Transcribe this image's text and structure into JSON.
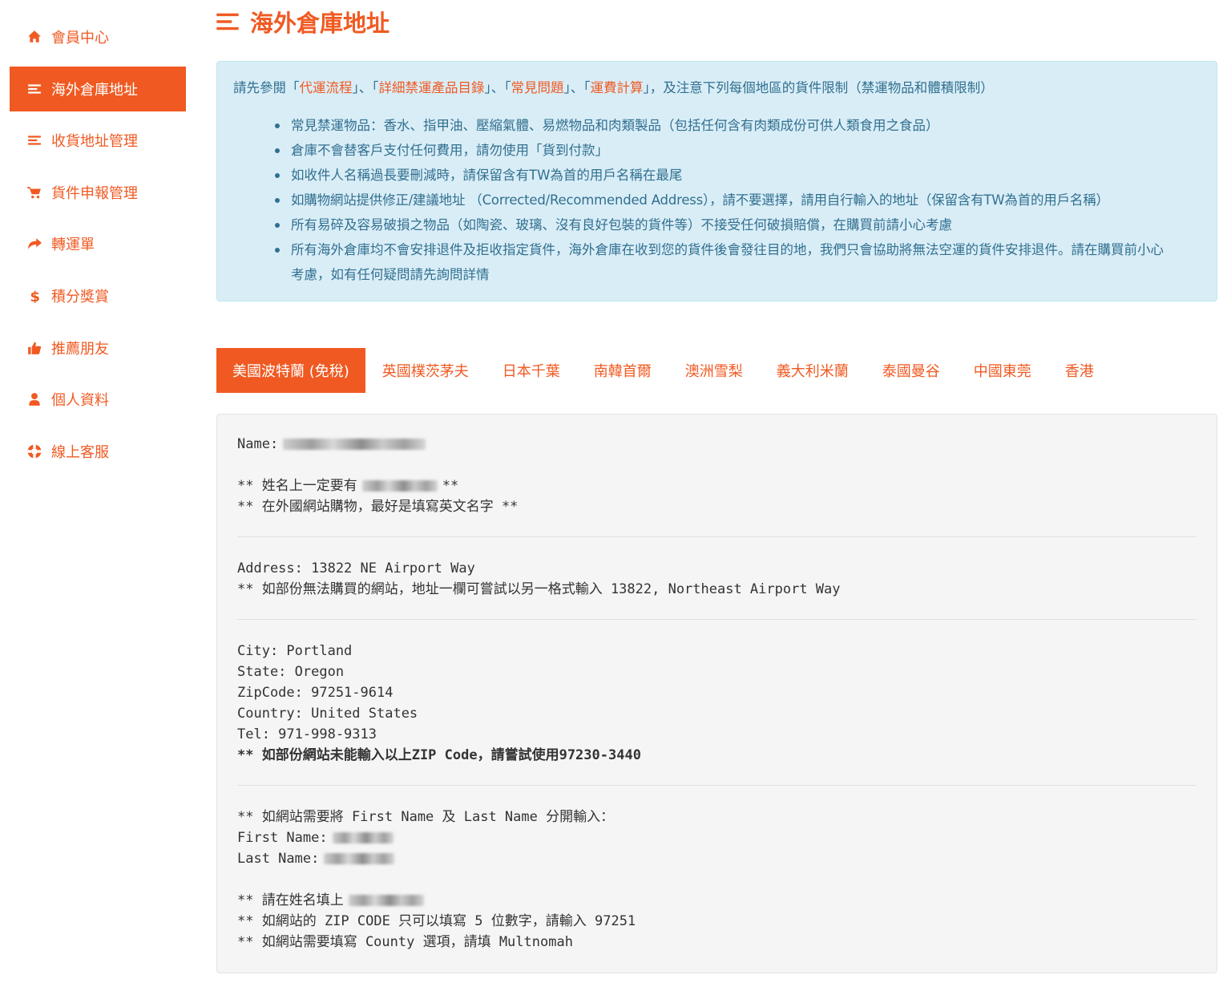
{
  "sidebar": {
    "items": [
      {
        "label": "會員中心",
        "icon": "home-icon"
      },
      {
        "label": "海外倉庫地址",
        "icon": "list-icon",
        "active": true
      },
      {
        "label": "收貨地址管理",
        "icon": "list-icon"
      },
      {
        "label": "貨件申報管理",
        "icon": "cart-icon"
      },
      {
        "label": "轉運單",
        "icon": "share-icon"
      },
      {
        "label": "積分獎賞",
        "icon": "dollar-icon"
      },
      {
        "label": "推薦朋友",
        "icon": "thumbs-up-icon"
      },
      {
        "label": "個人資料",
        "icon": "user-icon"
      },
      {
        "label": "線上客服",
        "icon": "lifebuoy-icon"
      }
    ]
  },
  "header": {
    "title": "海外倉庫地址",
    "icon": "list-icon"
  },
  "info": {
    "intro_prefix": "請先參閱「",
    "link1": "代運流程",
    "sep1": "」、「",
    "link2": "詳細禁運產品目錄",
    "sep2": "」、「",
    "link3": "常見問題",
    "sep3": "」、「",
    "link4": "運費計算",
    "intro_suffix": "」，及注意下列每個地區的貨件限制（禁運物品和體積限制）",
    "bullets": [
      "常見禁運物品：香水、指甲油、壓縮氣體、易燃物品和肉類製品（包括任何含有肉類成份可供人類食用之食品）",
      "倉庫不會替客戶支付任何費用，請勿使用「貨到付款」",
      "如收件人名稱過長要刪減時，請保留含有TW為首的用戶名稱在最尾",
      "如購物網站提供修正/建議地址 （Corrected/Recommended Address），請不要選擇，請用自行輸入的地址（保留含有TW為首的用戶名稱）",
      "所有易碎及容易破損之物品（如陶瓷、玻璃、沒有良好包裝的貨件等）不接受任何破損賠償，在購買前請小心考慮",
      "所有海外倉庫均不會安排退件及拒收指定貨件，海外倉庫在收到您的貨件後會發往目的地，我們只會協助將無法空運的貨件安排退件。請在購買前小心考慮，如有任何疑問請先詢問詳情"
    ]
  },
  "colors": {
    "accent": "#f05a22",
    "info_bg": "#d9edf7",
    "info_text": "#31708f",
    "panel_bg": "#f5f5f5"
  },
  "tabs": [
    {
      "label": "美國波特蘭 (免稅)",
      "active": true
    },
    {
      "label": "英國樸茨茅夫"
    },
    {
      "label": "日本千葉"
    },
    {
      "label": "南韓首爾"
    },
    {
      "label": "澳洲雪梨"
    },
    {
      "label": "義大利米蘭"
    },
    {
      "label": "泰國曼谷"
    },
    {
      "label": "中國東莞"
    },
    {
      "label": "香港"
    }
  ],
  "panel": {
    "name_label": "Name:",
    "name_note1_prefix": "** 姓名上一定要有",
    "name_note1_suffix": "**",
    "name_note2": "** 在外國網站購物，最好是填寫英文名字 **",
    "address": "Address: 13822 NE Airport Way",
    "address_note": "** 如部份無法購買的網站，地址一欄可嘗試以另一格式輸入 13822, Northeast Airport Way",
    "city": "City: Portland",
    "state": "State: Oregon",
    "zip": "ZipCode: 97251-9614",
    "country": "Country: United States",
    "tel": "Tel: 971-998-9313",
    "zip_note": "** 如部份網站未能輸入以上ZIP Code，請嘗試使用97230-3440",
    "split_note": "** 如網站需要將 First Name 及 Last Name 分開輸入：",
    "first_name_label": "First Name:",
    "last_name_label": "Last Name:",
    "fill_name_note": "** 請在姓名填上",
    "zip5_note": "** 如網站的 ZIP CODE 只可以填寫 5 位數字，請輸入 97251",
    "county_note": "** 如網站需要填寫 County 選項，請填 Multnomah"
  }
}
